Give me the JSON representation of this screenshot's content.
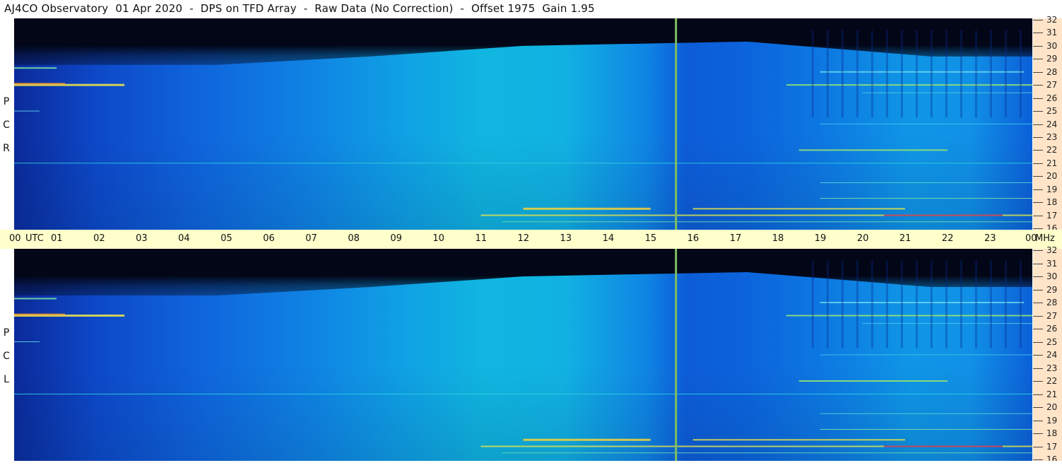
{
  "title": "AJ4CO Observatory  01 Apr 2020  -  DPS on TFD Array  -  Raw Data (No Correction)  -  Offset 1975  Gain 1.95",
  "panels": [
    {
      "name": "RCP",
      "letters": [
        "R",
        "C",
        "P"
      ]
    },
    {
      "name": "LCP",
      "letters": [
        "L",
        "C",
        "P"
      ]
    }
  ],
  "colors": {
    "axis_band": "#ffffcc",
    "tick_band": "#ffe4c8",
    "dark_sky": "#020616",
    "marker_line": "#7fbf5f"
  },
  "chart_data": {
    "type": "heatmap",
    "title": "AJ4CO Observatory  01 Apr 2020  -  DPS on TFD Array  -  Raw Data (No Correction)  -  Offset 1975  Gain 1.95",
    "xlabel": "UTC",
    "ylabel": "MHz",
    "x_ticks": [
      "00",
      "01",
      "02",
      "03",
      "04",
      "05",
      "06",
      "07",
      "08",
      "09",
      "10",
      "11",
      "12",
      "13",
      "14",
      "15",
      "16",
      "17",
      "18",
      "19",
      "20",
      "21",
      "22",
      "23",
      "00"
    ],
    "y_ticks": [
      "16",
      "17",
      "18",
      "19",
      "20",
      "21",
      "22",
      "23",
      "24",
      "25",
      "26",
      "27",
      "28",
      "29",
      "30",
      "31",
      "32"
    ],
    "xlim": [
      0,
      24
    ],
    "ylim": [
      16,
      32
    ],
    "x_unit_label": "UTC",
    "y_unit_label": "MHz",
    "marker_time_utc": 15.6,
    "emission_lines_mhz": [
      17.0,
      17.5,
      18.0,
      21.0,
      22.0,
      25.0,
      27.0,
      28.3
    ],
    "series": [
      {
        "name": "RCP"
      },
      {
        "name": "LCP"
      }
    ]
  }
}
